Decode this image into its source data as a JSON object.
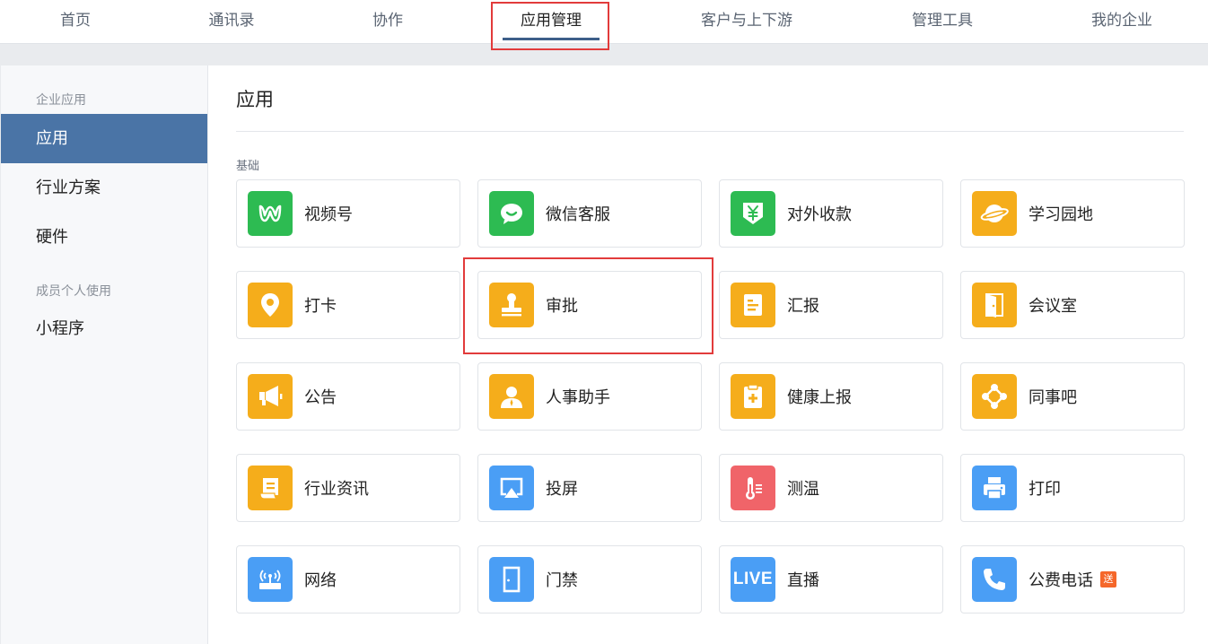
{
  "topnav": {
    "items": [
      {
        "label": "首页"
      },
      {
        "label": "通讯录"
      },
      {
        "label": "协作"
      },
      {
        "label": "应用管理"
      },
      {
        "label": "客户与上下游"
      },
      {
        "label": "管理工具"
      },
      {
        "label": "我的企业"
      }
    ],
    "active_index": 3
  },
  "sidebar": {
    "sections": [
      {
        "title": "企业应用",
        "items": [
          {
            "label": "应用"
          },
          {
            "label": "行业方案"
          },
          {
            "label": "硬件"
          }
        ]
      },
      {
        "title": "成员个人使用",
        "items": [
          {
            "label": "小程序"
          }
        ]
      }
    ],
    "active_item": "应用"
  },
  "main": {
    "title": "应用",
    "group_title": "基础",
    "apps": [
      {
        "name": "视频号",
        "icon": "video-channel-icon",
        "color": "#2dbb52"
      },
      {
        "name": "微信客服",
        "icon": "chat-bubble-icon",
        "color": "#2dbb52"
      },
      {
        "name": "对外收款",
        "icon": "yuan-shield-icon",
        "color": "#2dbb52"
      },
      {
        "name": "学习园地",
        "icon": "planet-icon",
        "color": "#f5ad1b"
      },
      {
        "name": "打卡",
        "icon": "location-pin-icon",
        "color": "#f5ad1b"
      },
      {
        "name": "审批",
        "icon": "stamp-icon",
        "color": "#f5ad1b"
      },
      {
        "name": "汇报",
        "icon": "report-icon",
        "color": "#f5ad1b"
      },
      {
        "name": "会议室",
        "icon": "door-icon",
        "color": "#f5ad1b"
      },
      {
        "name": "公告",
        "icon": "megaphone-icon",
        "color": "#f5ad1b"
      },
      {
        "name": "人事助手",
        "icon": "person-icon",
        "color": "#f5ad1b"
      },
      {
        "name": "健康上报",
        "icon": "health-clipboard-icon",
        "color": "#f5ad1b"
      },
      {
        "name": "同事吧",
        "icon": "network-nodes-icon",
        "color": "#f5ad1b"
      },
      {
        "name": "行业资讯",
        "icon": "scroll-icon",
        "color": "#f5ad1b"
      },
      {
        "name": "投屏",
        "icon": "screen-cast-icon",
        "color": "#4a9ef5"
      },
      {
        "name": "测温",
        "icon": "thermometer-icon",
        "color": "#f06469"
      },
      {
        "name": "打印",
        "icon": "printer-icon",
        "color": "#4a9ef5"
      },
      {
        "name": "网络",
        "icon": "router-icon",
        "color": "#4a9ef5"
      },
      {
        "name": "门禁",
        "icon": "access-door-icon",
        "color": "#4a9ef5"
      },
      {
        "name": "直播",
        "icon": "live-icon",
        "color": "#4a9ef5",
        "icon_text": "LIVE"
      },
      {
        "name": "公费电话",
        "icon": "phone-icon",
        "color": "#4a9ef5",
        "badge": "送"
      }
    ]
  },
  "colors": {
    "accent": "#4a74a6",
    "nav_underline": "#3e5f8a",
    "highlight": "#e23b3b"
  }
}
